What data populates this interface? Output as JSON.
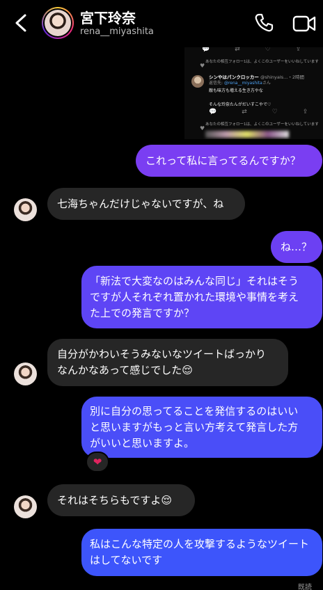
{
  "header": {
    "name": "宮下玲奈",
    "username": "rena__miyashita",
    "back_icon": "chevron-left-icon",
    "call_icon": "phone-icon",
    "video_icon": "video-camera-icon"
  },
  "tweet": {
    "note1": "あなたの相互フォロー1は、よくこのユーザーをいいねしています",
    "author": "シンやはパンクロッカー",
    "handle": "@shinyaIs...・2時間",
    "reply_prefix": "返信先:",
    "reply_to": "@rena__miyashita",
    "reply_suffix": "さん",
    "line1": "敵も味方も増える生き方やな",
    "line2": "そんな玲奈たんがだいすこやで♡",
    "note2": "あなたの相互フォロー1は、よくこのユーザーをいいねしています"
  },
  "messages": [
    {
      "side": "out",
      "text": "これって私に言ってるんですか？"
    },
    {
      "side": "in",
      "text": "七海ちゃんだけじゃないですが、ね"
    },
    {
      "side": "out",
      "text": "ね…？"
    },
    {
      "side": "out",
      "lines": [
        "「新法で大変なのはみんな同じ」それはそう",
        "ですが人それぞれ置かれた環境や事情を考え",
        "た上での発言ですか？"
      ]
    },
    {
      "side": "in",
      "lines": [
        "自分がかわいそうみないなツイートばっかり",
        "なんかなあって感じでした😌"
      ]
    },
    {
      "side": "out",
      "lines": [
        "別に自分の思ってることを発信するのはいい",
        "と思いますがもっと言い方考えて発言した方",
        "がいいと思いますよ。"
      ],
      "reaction": "❤"
    },
    {
      "side": "in",
      "text": "それはそちらもですよ😌"
    },
    {
      "side": "out",
      "lines": [
        "私はこんな特定の人を攻撃するようなツイート",
        "はしてないです"
      ]
    }
  ],
  "status": {
    "seen": "既読"
  },
  "colors": {
    "bubble_top": "#8a3ff0",
    "bubble_bottom": "#3d5bff",
    "incoming": "#262626"
  }
}
